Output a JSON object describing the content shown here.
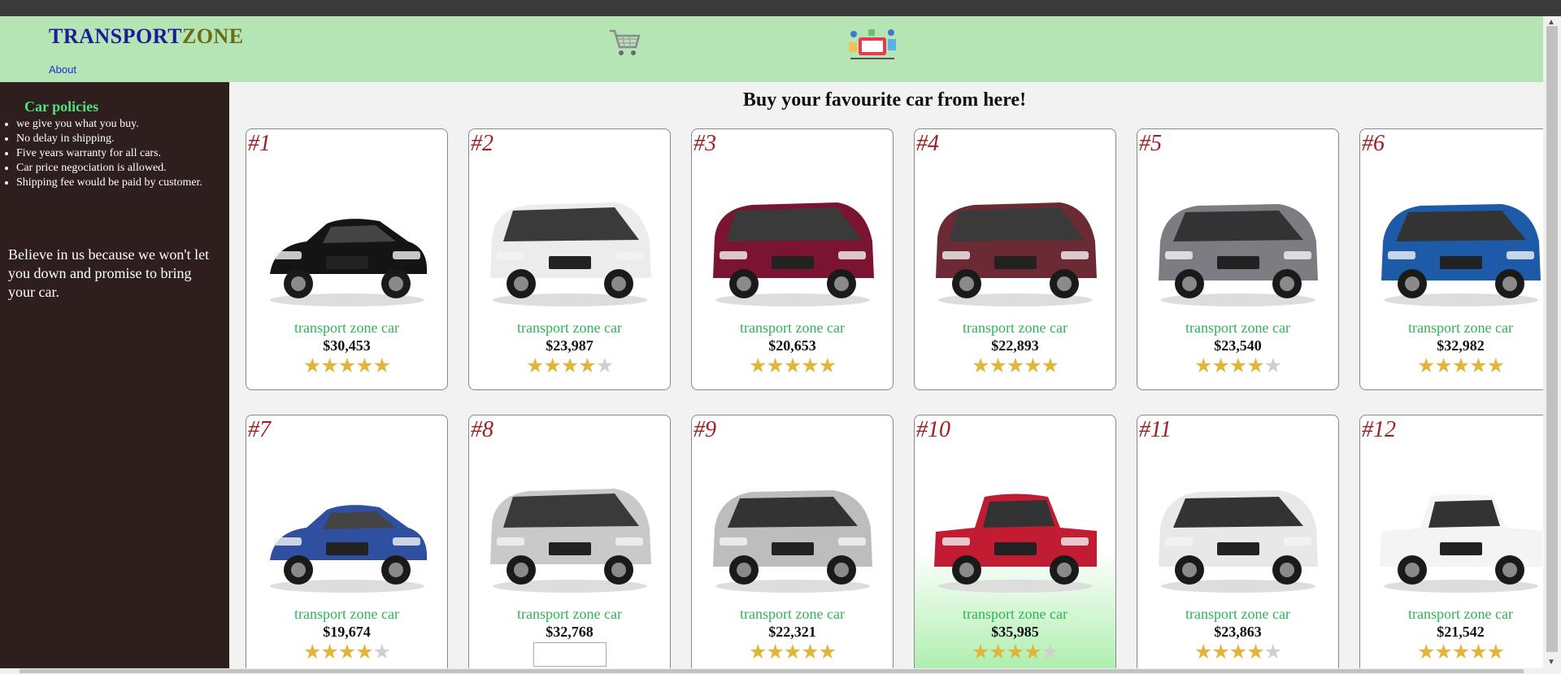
{
  "header": {
    "logo_part1": "TRANSPORT",
    "logo_part2": "ZONE",
    "about_label": "About",
    "icons": [
      "shopping-cart-icon",
      "delivery-illustration-icon"
    ]
  },
  "sidebar": {
    "policy_title": "Car policies",
    "policies": [
      "we give you what you buy.",
      "No delay in shipping.",
      "Five years warranty for all cars.",
      "Car price negociation is allowed.",
      "Shipping fee would be paid by customer."
    ],
    "believe_text": "Believe in us because we won't let you down and promise to bring your car."
  },
  "main": {
    "title": "Buy your favourite car from here!",
    "cards": [
      {
        "num": "#1",
        "name": "transport zone car",
        "price": "$30,453",
        "rating": 5,
        "color": "#141414",
        "kind": "sport"
      },
      {
        "num": "#2",
        "name": "transport zone car",
        "price": "$23,987",
        "rating": 4,
        "color": "#ececec",
        "kind": "van"
      },
      {
        "num": "#3",
        "name": "transport zone car",
        "price": "$20,653",
        "rating": 5,
        "color": "#7a1430",
        "kind": "van"
      },
      {
        "num": "#4",
        "name": "transport zone car",
        "price": "$22,893",
        "rating": 5,
        "color": "#6b2a34",
        "kind": "van"
      },
      {
        "num": "#5",
        "name": "transport zone car",
        "price": "$23,540",
        "rating": 4,
        "color": "#7c7c82",
        "kind": "suv"
      },
      {
        "num": "#6",
        "name": "transport zone car",
        "price": "$32,982",
        "rating": 5,
        "color": "#1d5aa8",
        "kind": "suv"
      },
      {
        "num": "#7",
        "name": "transport zone car",
        "price": "$19,674",
        "rating": 4,
        "color": "#2f4fa0",
        "kind": "sport"
      },
      {
        "num": "#8",
        "name": "transport zone car",
        "price": "$32,768",
        "rating": 0,
        "color": "#c9c9c9",
        "kind": "van"
      },
      {
        "num": "#9",
        "name": "transport zone car",
        "price": "$22,321",
        "rating": 5,
        "color": "#bdbdbd",
        "kind": "suv"
      },
      {
        "num": "#10",
        "name": "transport zone car",
        "price": "$35,985",
        "rating": 4,
        "color": "#c21c33",
        "kind": "truck"
      },
      {
        "num": "#11",
        "name": "transport zone car",
        "price": "$23,863",
        "rating": 4,
        "color": "#e8e8e8",
        "kind": "suv"
      },
      {
        "num": "#12",
        "name": "transport zone car",
        "price": "$21,542",
        "rating": 5,
        "color": "#f4f4f4",
        "kind": "truck"
      }
    ]
  }
}
